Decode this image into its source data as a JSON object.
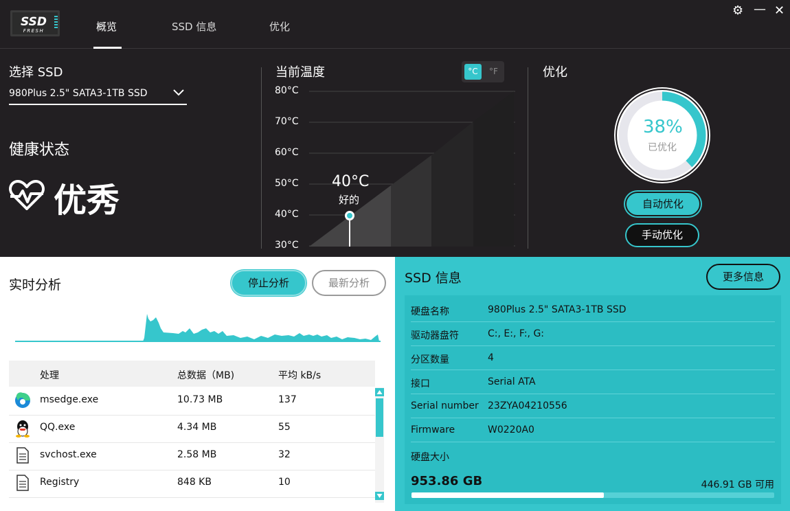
{
  "app": {
    "logo_text": "SSD",
    "logo_sub": "FRESH"
  },
  "tabs": [
    {
      "label": "概览",
      "active": true
    },
    {
      "label": "SSD 信息",
      "active": false
    },
    {
      "label": "优化",
      "active": false
    }
  ],
  "window_controls": {
    "settings": "⚙",
    "minimize": "—",
    "close": "✕"
  },
  "select_ssd": {
    "title": "选择 SSD",
    "value": "980Plus 2.5\" SATA3-1TB SSD"
  },
  "health": {
    "title": "健康状态",
    "value": "优秀"
  },
  "temperature": {
    "title": "当前温度",
    "unit_c": "°C",
    "unit_f": "°F",
    "active_unit": "C",
    "ticks": [
      "80°C",
      "70°C",
      "60°C",
      "50°C",
      "40°C",
      "30°C"
    ],
    "current": 40,
    "current_label": "40°C",
    "status": "好的"
  },
  "optimize": {
    "title": "优化",
    "percent": 38,
    "percent_label": "38%",
    "sub_label": "已优化",
    "auto_label": "自动优化",
    "manual_label": "手动优化"
  },
  "realtime": {
    "title": "实时分析",
    "stop_label": "停止分析",
    "refresh_label": "最新分析",
    "columns": {
      "process": "处理",
      "total": "总数据（MB)",
      "avg": "平均 kB/s"
    },
    "rows": [
      {
        "icon": "edge-icon",
        "name": "msedge.exe",
        "total": "10.73 MB",
        "avg": "137"
      },
      {
        "icon": "qq-icon",
        "name": "QQ.exe",
        "total": "4.34 MB",
        "avg": "55"
      },
      {
        "icon": "file-icon",
        "name": "svchost.exe",
        "total": "2.58 MB",
        "avg": "32"
      },
      {
        "icon": "file-icon",
        "name": "Registry",
        "total": "848 KB",
        "avg": "10"
      }
    ]
  },
  "ssd_info": {
    "title": "SSD 信息",
    "more_label": "更多信息",
    "rows": [
      {
        "key": "硬盘名称",
        "value": "980Plus 2.5\" SATA3-1TB SSD"
      },
      {
        "key": "驱动器盘符",
        "value": "C:, E:, F:, G:"
      },
      {
        "key": "分区数量",
        "value": "4"
      },
      {
        "key": "接口",
        "value": "Serial ATA"
      },
      {
        "key": "Serial number",
        "value": "23ZYA04210556"
      },
      {
        "key": "Firmware",
        "value": "W0220A0"
      }
    ],
    "capacity_label": "硬盘大小",
    "capacity_total": "953.86 GB",
    "capacity_free": "446.91 GB 可用",
    "used_fraction": 0.53
  },
  "colors": {
    "accent": "#36c6cc",
    "dark_bg": "#221f22"
  }
}
